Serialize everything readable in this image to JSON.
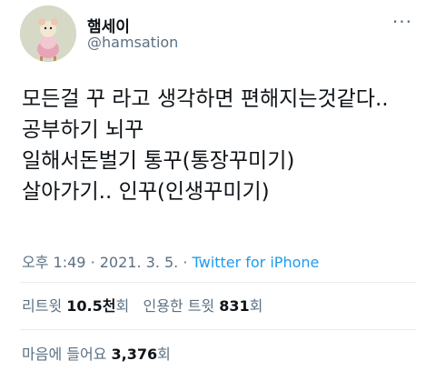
{
  "user": {
    "name": "햄세이",
    "handle": "@hamsation",
    "more_icon": "more-horizontal-icon"
  },
  "tweet": {
    "lines": [
      "모든걸 꾸 라고 생각하면 편해지는것같다..",
      "공부하기 뇌꾸",
      "일해서돈벌기 통꾸(통장꾸미기)",
      "살아가기.. 인꾸(인생꾸미기)"
    ]
  },
  "meta": {
    "time": "오후 1:49",
    "separator": "·",
    "date": "2021. 3. 5.",
    "source": "Twitter for iPhone"
  },
  "stats": {
    "retweets_label": "리트윗",
    "retweets_value": "10.5천",
    "retweets_suffix": "회",
    "quotes_label": "인용한 트윗",
    "quotes_value": "831",
    "quotes_suffix": "회",
    "likes_label": "마음에 들어요",
    "likes_value": "3,376",
    "likes_suffix": "회"
  },
  "colors": {
    "text": "#0f1419",
    "secondary": "#5b7083",
    "link": "#1d9bf0",
    "divider": "#e6ecf0"
  }
}
